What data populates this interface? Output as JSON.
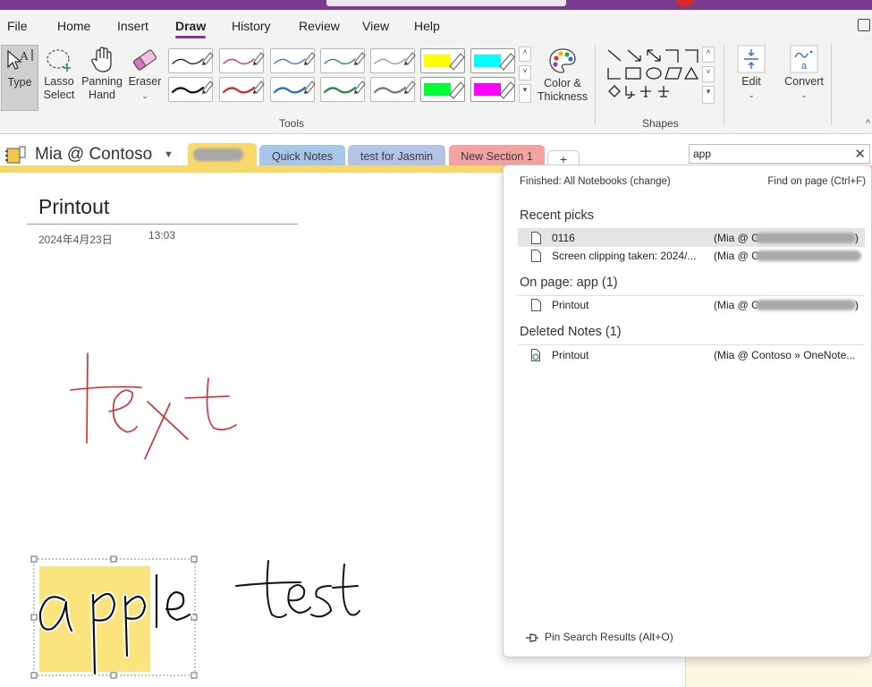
{
  "menu": {
    "items": [
      {
        "id": "file",
        "label": "File"
      },
      {
        "id": "home",
        "label": "Home"
      },
      {
        "id": "insert",
        "label": "Insert"
      },
      {
        "id": "draw",
        "label": "Draw"
      },
      {
        "id": "history",
        "label": "History"
      },
      {
        "id": "review",
        "label": "Review"
      },
      {
        "id": "view",
        "label": "View"
      },
      {
        "id": "help",
        "label": "Help"
      }
    ],
    "active": "Draw"
  },
  "ribbon": {
    "type_label": "Type",
    "lasso_label": "Lasso\nSelect",
    "panning_label": "Panning\nHand",
    "eraser_label": "Eraser",
    "color_label": "Color &\nThickness",
    "edit_label": "Edit",
    "convert_label": "Convert",
    "tools_group": "Tools",
    "shapes_group": "Shapes",
    "pen_colors_row1": [
      "#222222",
      "#d43a3a",
      "#3a78c8",
      "#2e8b57",
      "#9a9a9a",
      "#ffff00",
      "#00ffff"
    ],
    "pen_colors_row2": [
      "#111111",
      "#e02020",
      "#1f6fbf",
      "#1f8a3a",
      "#777777",
      "#00ff33",
      "#ff00ff"
    ]
  },
  "notebook": {
    "name": "Mia @ Contoso",
    "sections": [
      {
        "id": "blurred",
        "label": ""
      },
      {
        "id": "quick-notes",
        "label": "Quick Notes"
      },
      {
        "id": "test-jasmin",
        "label": "test for Jasmin"
      },
      {
        "id": "new-section-1",
        "label": "New Section 1"
      }
    ],
    "add_label": "+"
  },
  "search": {
    "value": "app",
    "status": "Finished:  All Notebooks (change)",
    "find_on_page": "Find on page (Ctrl+F)",
    "recent_heading": "Recent picks",
    "recent": [
      {
        "title": "0116",
        "location": "(Mia @ C",
        "location_end": ")"
      },
      {
        "title": "Screen clipping taken: 2024/...",
        "location": "(Mia @ C",
        "location_end": ""
      }
    ],
    "onpage_heading": "On page:  app (1)",
    "onpage": [
      {
        "title": "Printout",
        "location": "(Mia @ C",
        "location_end": ")"
      }
    ],
    "deleted_heading": "Deleted Notes (1)",
    "deleted": [
      {
        "title": "Printout",
        "location": "(Mia @ Contoso » OneNote..."
      }
    ],
    "pin_label": "Pin Search Results (Alt+O)"
  },
  "page": {
    "title": "Printout",
    "date": "2024年4月23日",
    "time": "13:03"
  }
}
